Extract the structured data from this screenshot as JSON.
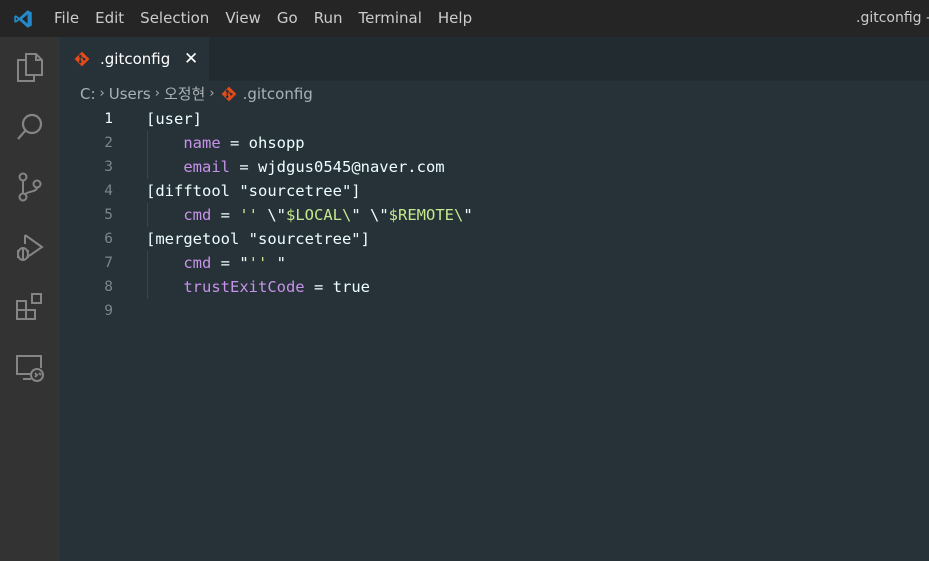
{
  "menu": {
    "items": [
      "File",
      "Edit",
      "Selection",
      "View",
      "Go",
      "Run",
      "Terminal",
      "Help"
    ]
  },
  "window": {
    "title": ".gitconfig - Visual Studio Code"
  },
  "activity_bar": {
    "icons": [
      "explorer-icon",
      "search-icon",
      "source-control-icon",
      "run-debug-icon",
      "extensions-icon",
      "remote-explorer-icon"
    ]
  },
  "tab": {
    "label": ".gitconfig",
    "close": "✕",
    "icon": "git-icon"
  },
  "breadcrumb": {
    "parts": [
      "C:",
      "Users",
      "오정현",
      ".gitconfig"
    ],
    "separator": "›"
  },
  "editor": {
    "active_line": 1,
    "lines": [
      {
        "n": "1",
        "tokens": [
          {
            "t": "[user]",
            "c": "c"
          }
        ]
      },
      {
        "n": "2",
        "tokens": [
          {
            "t": "    ",
            "c": "c"
          },
          {
            "t": "name",
            "c": "k"
          },
          {
            "t": " = ohsopp",
            "c": "c"
          }
        ]
      },
      {
        "n": "3",
        "tokens": [
          {
            "t": "    ",
            "c": "c"
          },
          {
            "t": "email",
            "c": "k"
          },
          {
            "t": " = wjdgus0545@naver.com",
            "c": "c"
          }
        ]
      },
      {
        "n": "4",
        "tokens": [
          {
            "t": "[difftool \"sourcetree\"]",
            "c": "c"
          }
        ]
      },
      {
        "n": "5",
        "tokens": [
          {
            "t": "    ",
            "c": "c"
          },
          {
            "t": "cmd",
            "c": "k"
          },
          {
            "t": " = ",
            "c": "c"
          },
          {
            "t": "''",
            "c": "s"
          },
          {
            "t": " \\\"",
            "c": "c"
          },
          {
            "t": "$LOCAL\\",
            "c": "s"
          },
          {
            "t": "\" \\\"",
            "c": "c"
          },
          {
            "t": "$REMOTE\\",
            "c": "s"
          },
          {
            "t": "\"",
            "c": "c"
          }
        ]
      },
      {
        "n": "6",
        "tokens": [
          {
            "t": "[mergetool \"sourcetree\"]",
            "c": "c"
          }
        ]
      },
      {
        "n": "7",
        "tokens": [
          {
            "t": "    ",
            "c": "c"
          },
          {
            "t": "cmd",
            "c": "k"
          },
          {
            "t": " = ",
            "c": "c"
          },
          {
            "t": "\"",
            "c": "c"
          },
          {
            "t": "''",
            "c": "s"
          },
          {
            "t": " \"",
            "c": "c"
          }
        ]
      },
      {
        "n": "8",
        "tokens": [
          {
            "t": "    ",
            "c": "c"
          },
          {
            "t": "trustExitCode",
            "c": "k"
          },
          {
            "t": " = true",
            "c": "c"
          }
        ]
      },
      {
        "n": "9",
        "tokens": []
      }
    ]
  },
  "colors": {
    "editor_background": "#263238",
    "keyword": "#c792ea",
    "string": "#c3e88d",
    "git_orange": "#e64a19",
    "vscode_blue": "#2489ca"
  }
}
